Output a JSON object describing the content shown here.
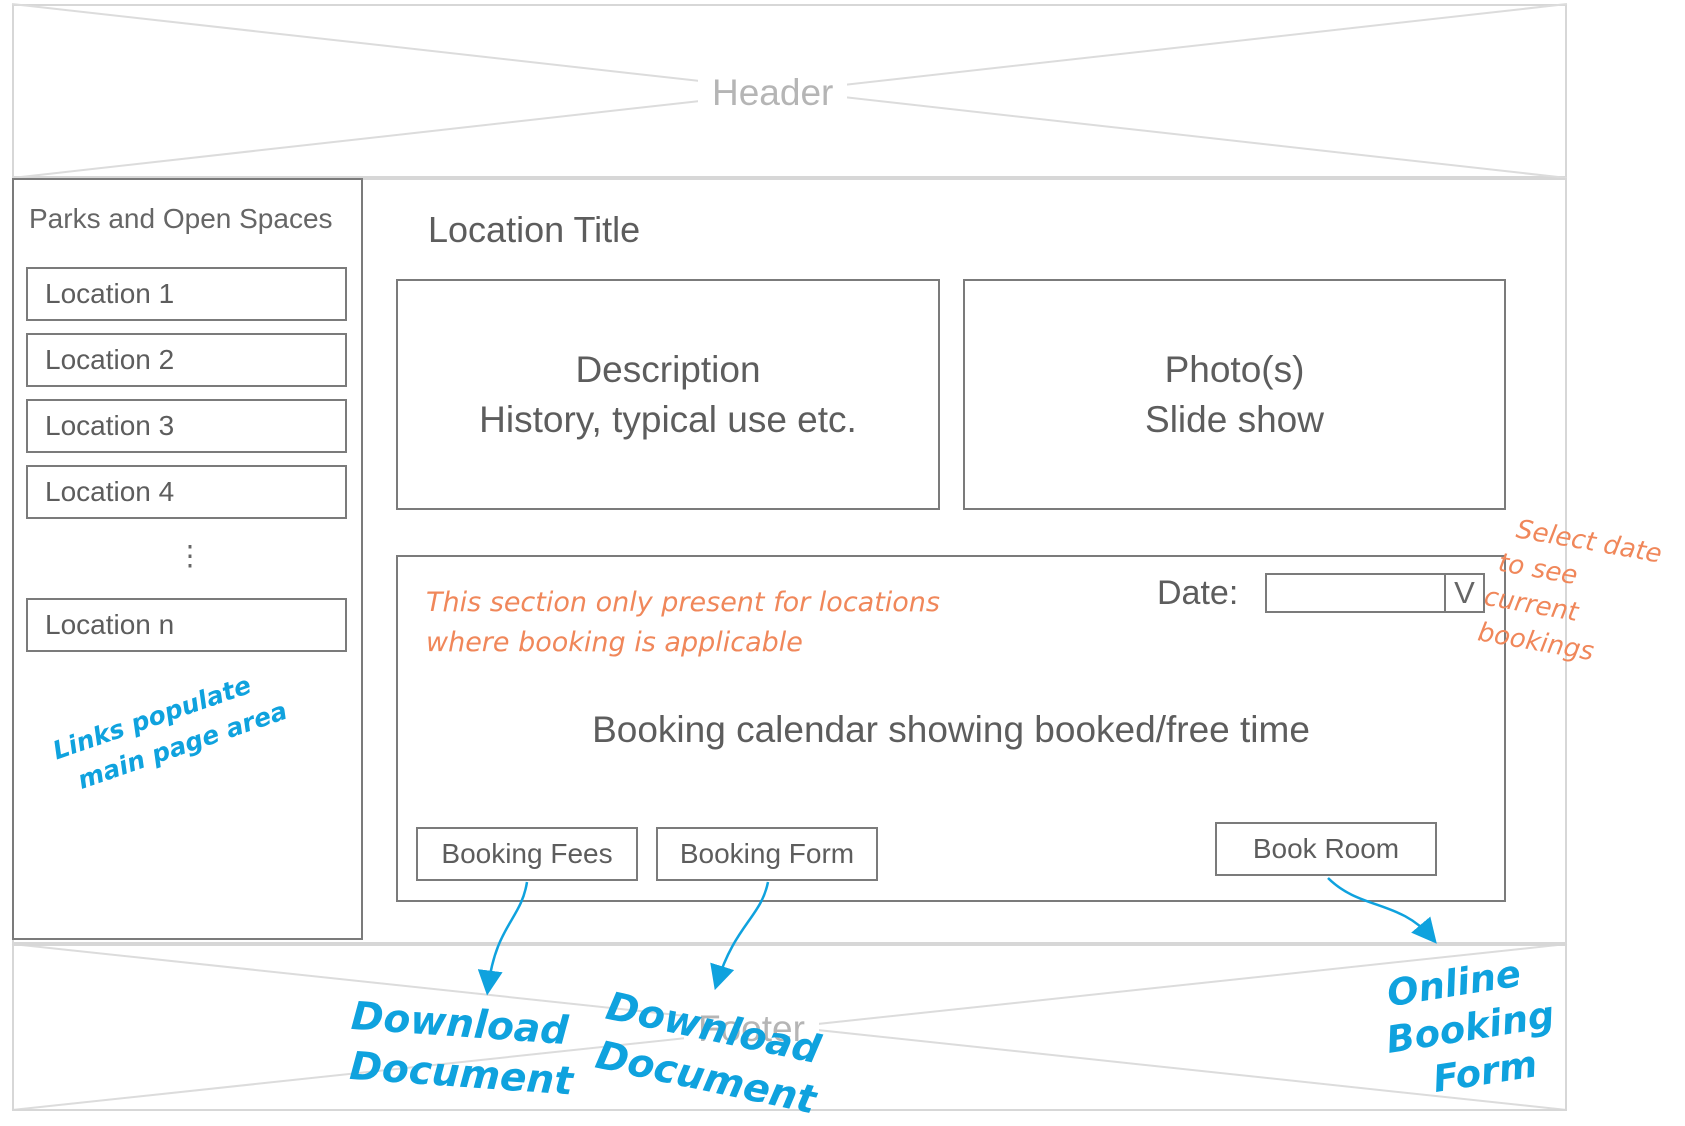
{
  "header": {
    "label": "Header"
  },
  "sidebar": {
    "title": "Parks and Open Spaces",
    "items": [
      {
        "label": "Location  1"
      },
      {
        "label": "Location 2"
      },
      {
        "label": "Location 3"
      },
      {
        "label": "Location 4"
      }
    ],
    "ellipsis": "⋮",
    "last_item": {
      "label": "Location n"
    },
    "note_lines": [
      "Links populate",
      "main page area"
    ]
  },
  "main": {
    "location_title": "Location Title",
    "description": {
      "line1": "Description",
      "line2": "History, typical use etc."
    },
    "photos": {
      "line1": "Photo(s)",
      "line2": "Slide show"
    },
    "booking": {
      "note_line1": "This section only present for locations",
      "note_line2": "where booking is applicable",
      "date_label": "Date:",
      "date_value": "",
      "dropdown_label": "V",
      "calendar_text": "Booking calendar showing booked/free time",
      "buttons": {
        "fees": "Booking Fees",
        "form": "Booking Form",
        "book_room": "Book Room"
      }
    }
  },
  "side_note": {
    "lines": [
      "Select date",
      "to see",
      "current",
      "bookings"
    ]
  },
  "footer": {
    "label": "Footer",
    "notes": {
      "download1": [
        "Download",
        "Document"
      ],
      "download2": [
        "Download",
        "Document"
      ],
      "online": [
        "Online",
        "Booking",
        "Form"
      ]
    }
  },
  "colors": {
    "wireframe_border": "#7b7b7b",
    "wireframe_light": "#d7d7d7",
    "text_gray": "#5d5d5d",
    "annotation_orange": "#f0875a",
    "annotation_blue": "#0fa2de"
  }
}
